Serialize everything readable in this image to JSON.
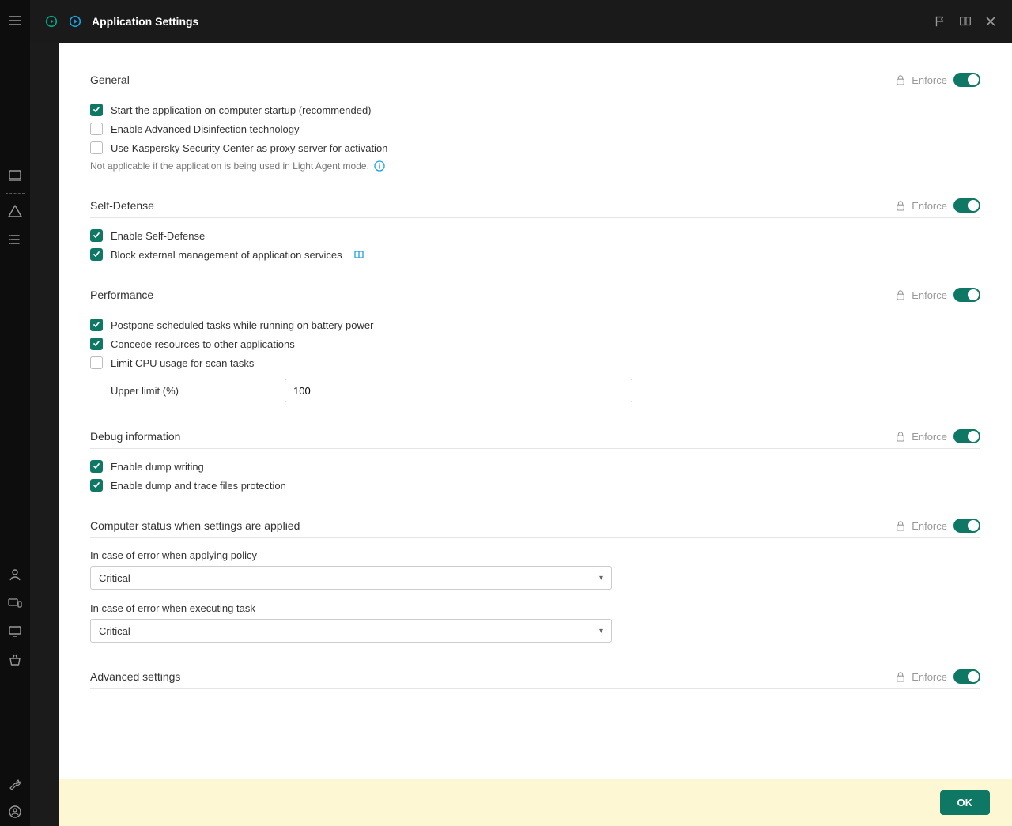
{
  "header": {
    "title": "Application Settings"
  },
  "enforce_label": "Enforce",
  "sections": {
    "general": {
      "title": "General",
      "startup": "Start the application on computer startup (recommended)",
      "disinfection": "Enable Advanced Disinfection technology",
      "proxy": "Use Kaspersky Security Center as proxy server for activation",
      "help": "Not applicable if the application is being used in Light Agent mode."
    },
    "selfdefense": {
      "title": "Self-Defense",
      "enable": "Enable Self-Defense",
      "block": "Block external management of application services"
    },
    "performance": {
      "title": "Performance",
      "postpone": "Postpone scheduled tasks while running on battery power",
      "concede": "Concede resources to other applications",
      "limitcpu": "Limit CPU usage for scan tasks",
      "upper_label": "Upper limit (%)",
      "upper_value": "100"
    },
    "debug": {
      "title": "Debug information",
      "dump": "Enable dump writing",
      "protect": "Enable dump and trace files protection"
    },
    "status": {
      "title": "Computer status when settings are applied",
      "policy_label": "In case of error when applying policy",
      "policy_value": "Critical",
      "task_label": "In case of error when executing task",
      "task_value": "Critical"
    },
    "advanced": {
      "title": "Advanced settings"
    }
  },
  "footer": {
    "ok": "OK"
  }
}
